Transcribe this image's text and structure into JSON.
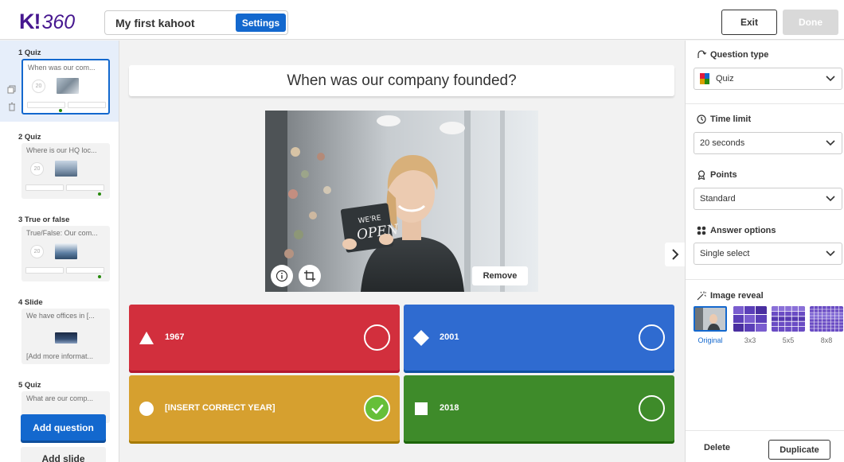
{
  "header": {
    "logo_mark": "K!",
    "logo_num": "360",
    "title": "My first kahoot",
    "settings_label": "Settings",
    "exit_label": "Exit",
    "done_label": "Done"
  },
  "sidebar": {
    "slides": [
      {
        "label": "1 Quiz",
        "text": "When was our com...",
        "timer": "20"
      },
      {
        "label": "2 Quiz",
        "text": "Where is our HQ loc...",
        "timer": "20"
      },
      {
        "label": "3 True or false",
        "text": "True/False: Our com...",
        "timer": "20"
      },
      {
        "label": "4 Slide",
        "text": "We have offices in [...",
        "subtext": "[Add more informat..."
      },
      {
        "label": "5 Quiz",
        "text": "What are our comp..."
      }
    ],
    "add_question": "Add question",
    "add_slide": "Add slide"
  },
  "main": {
    "question": "When was our company founded?",
    "sign_text_1": "WE'RE",
    "sign_text_2": "OPEN",
    "remove_label": "Remove",
    "answers": [
      {
        "text": "1967",
        "shape": "triangle",
        "color": "#d22f3d",
        "correct": false
      },
      {
        "text": "2001",
        "shape": "diamond",
        "color": "#2f6bd0",
        "correct": false
      },
      {
        "text": "[INSERT CORRECT YEAR]",
        "shape": "circle",
        "color": "#d6a02f",
        "correct": true
      },
      {
        "text": "2018",
        "shape": "square",
        "color": "#3e8b2a",
        "correct": false
      }
    ]
  },
  "panel": {
    "question_type": {
      "title": "Question type",
      "value": "Quiz"
    },
    "time_limit": {
      "title": "Time limit",
      "value": "20 seconds"
    },
    "points": {
      "title": "Points",
      "value": "Standard"
    },
    "answer_options": {
      "title": "Answer options",
      "value": "Single select"
    },
    "image_reveal": {
      "title": "Image reveal",
      "options": [
        "Original",
        "3x3",
        "5x5",
        "8x8"
      ],
      "selected": "Original"
    },
    "delete_label": "Delete",
    "duplicate_label": "Duplicate"
  },
  "colors": {
    "brand": "#46178f",
    "accent_blue": "#1368ce",
    "correct_green": "#66bf39"
  }
}
